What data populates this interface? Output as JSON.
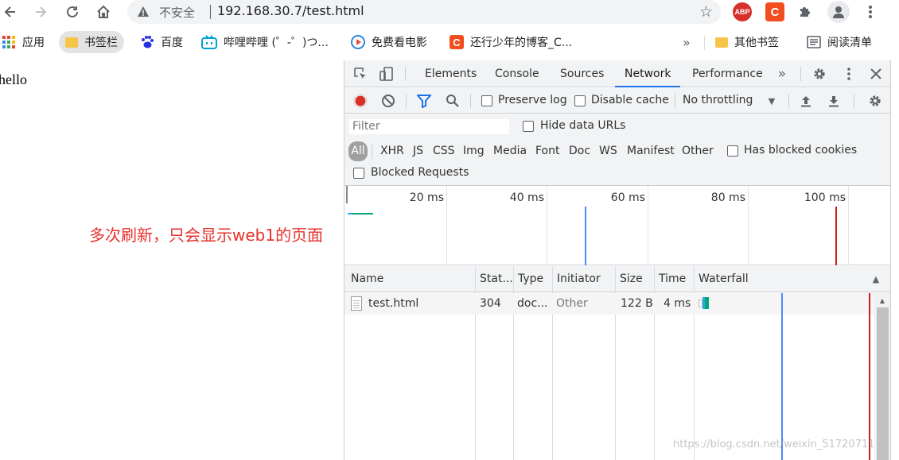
{
  "browser": {
    "address": {
      "security_text": "不安全",
      "url": "192.168.30.7/test.html"
    },
    "extensions": {
      "abp_label": "ABP",
      "c_label": "C"
    }
  },
  "bookmarks": {
    "items": [
      {
        "label": "应用"
      },
      {
        "label": "书签栏"
      },
      {
        "label": "百度"
      },
      {
        "label": "哔哩哔哩 (゜-゜)つ..."
      },
      {
        "label": "免费看电影"
      },
      {
        "label": "还行少年的博客_C..."
      }
    ],
    "more": "»",
    "other": "其他书签",
    "reading_list": "阅读清单"
  },
  "page": {
    "body_text": "hello",
    "annotation": "多次刷新，只会显示web1的页面"
  },
  "devtools": {
    "tabs": [
      "Elements",
      "Console",
      "Sources",
      "Network",
      "Performance"
    ],
    "active_tab": "Network",
    "network_toolbar": {
      "preserve_log": "Preserve log",
      "disable_cache": "Disable cache",
      "throttling": "No throttling"
    },
    "filter": {
      "placeholder": "Filter",
      "hide_data_urls": "Hide data URLs",
      "types": [
        "All",
        "XHR",
        "JS",
        "CSS",
        "Img",
        "Media",
        "Font",
        "Doc",
        "WS",
        "Manifest",
        "Other"
      ],
      "has_blocked_cookies": "Has blocked cookies",
      "blocked_requests": "Blocked Requests"
    },
    "overview": {
      "ticks": [
        "20 ms",
        "40 ms",
        "60 ms",
        "80 ms",
        "100 ms"
      ]
    },
    "table": {
      "headers": [
        "Name",
        "Stat...",
        "Type",
        "Initiator",
        "Size",
        "Time",
        "Waterfall"
      ],
      "rows": [
        {
          "name": "test.html",
          "status": "304",
          "type": "doc...",
          "initiator": "Other",
          "size": "122 B",
          "time": "4 ms"
        }
      ]
    },
    "colors": {
      "active_tab": "#1a73e8",
      "record": "#d93025",
      "dom_content_loaded": "#4a8af4",
      "load_event": "#c5221f",
      "waterfall_waiting": "#00a67e",
      "waterfall_download": "#24a8e6"
    }
  },
  "watermark": "https://blog.csdn.net/weixin_51720711"
}
